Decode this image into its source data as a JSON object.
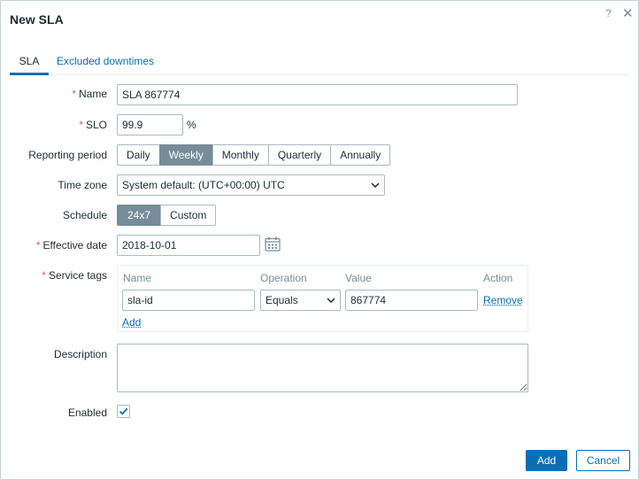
{
  "dialog": {
    "title": "New SLA",
    "help_icon": "?",
    "close_icon": "✕"
  },
  "tabs": [
    {
      "label": "SLA",
      "active": true
    },
    {
      "label": "Excluded downtimes",
      "active": false
    }
  ],
  "form": {
    "name": {
      "label": "Name",
      "value": "SLA 867774",
      "required": true
    },
    "slo": {
      "label": "SLO",
      "value": "99.9",
      "unit": "%",
      "required": true
    },
    "reporting_period": {
      "label": "Reporting period",
      "options": [
        "Daily",
        "Weekly",
        "Monthly",
        "Quarterly",
        "Annually"
      ],
      "selected": "Weekly"
    },
    "time_zone": {
      "label": "Time zone",
      "value": "System default: (UTC+00:00) UTC"
    },
    "schedule": {
      "label": "Schedule",
      "options": [
        "24x7",
        "Custom"
      ],
      "selected": "24x7"
    },
    "effective_date": {
      "label": "Effective date",
      "value": "2018-10-01",
      "required": true
    },
    "service_tags": {
      "label": "Service tags",
      "required": true,
      "headers": {
        "name": "Name",
        "operation": "Operation",
        "value": "Value",
        "action": "Action"
      },
      "rows": [
        {
          "name": "sla-id",
          "operation": "Equals",
          "value": "867774",
          "action": "Remove"
        }
      ],
      "add_label": "Add"
    },
    "description": {
      "label": "Description",
      "value": ""
    },
    "enabled": {
      "label": "Enabled",
      "checked": true
    }
  },
  "footer": {
    "add_label": "Add",
    "cancel_label": "Cancel"
  },
  "colors": {
    "accent": "#0a6eb4",
    "active_segment": "#768d99",
    "required": "#e45959"
  }
}
